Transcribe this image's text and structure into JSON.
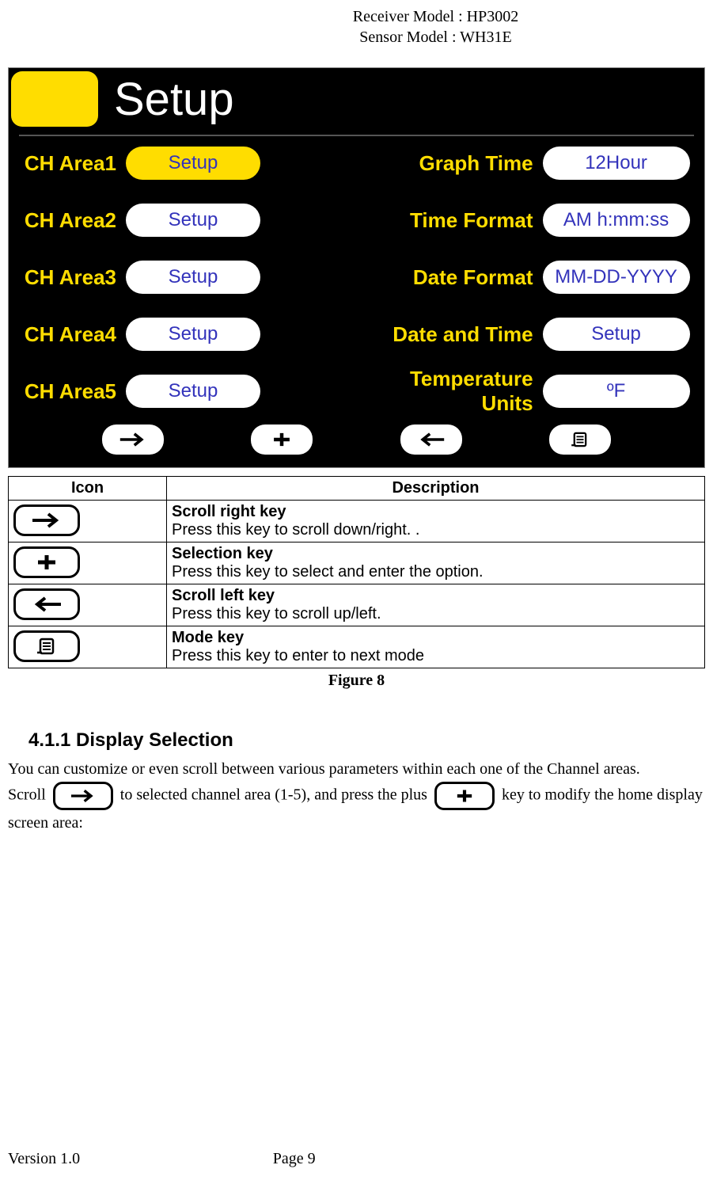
{
  "header": {
    "receiver_line": "Receiver Model : HP3002",
    "sensor_line": "Sensor Model : WH31E"
  },
  "screen": {
    "title": "Setup",
    "left_rows": [
      {
        "label": "CH Area1",
        "value": "Setup",
        "highlighted": true
      },
      {
        "label": "CH Area2",
        "value": "Setup",
        "highlighted": false
      },
      {
        "label": "CH Area3",
        "value": "Setup",
        "highlighted": false
      },
      {
        "label": "CH Area4",
        "value": "Setup",
        "highlighted": false
      },
      {
        "label": "CH Area5",
        "value": "Setup",
        "highlighted": false
      }
    ],
    "right_rows": [
      {
        "label": "Graph Time",
        "value": "12Hour"
      },
      {
        "label": "Time Format",
        "value": "AM h:mm:ss"
      },
      {
        "label": "Date Format",
        "value": "MM-DD-YYYY"
      },
      {
        "label": "Date and Time",
        "value": "Setup"
      },
      {
        "label": "Temperature Units",
        "value": "ºF"
      }
    ]
  },
  "table": {
    "head_icon": "Icon",
    "head_desc": "Description",
    "rows": [
      {
        "title": "Scroll right key",
        "desc": "Press this key to scroll down/right.    ."
      },
      {
        "title": "Selection key",
        "desc": "Press this key to select and enter the option."
      },
      {
        "title": "Scroll left key",
        "desc": "Press this key to scroll up/left."
      },
      {
        "title": "Mode key",
        "desc": "Press this key to enter to next mode"
      }
    ],
    "caption": "Figure 8"
  },
  "section": {
    "heading": "4.1.1  Display Selection",
    "para_1": "You can customize or even scroll between various parameters within each one of the Channel areas.",
    "para_2a": "Scroll ",
    "para_2b": " to selected channel area (1-5), and press the plus ",
    "para_2c": " key to modify the home display screen area:"
  },
  "footer": {
    "version": "Version 1.0",
    "page": "Page 9"
  }
}
